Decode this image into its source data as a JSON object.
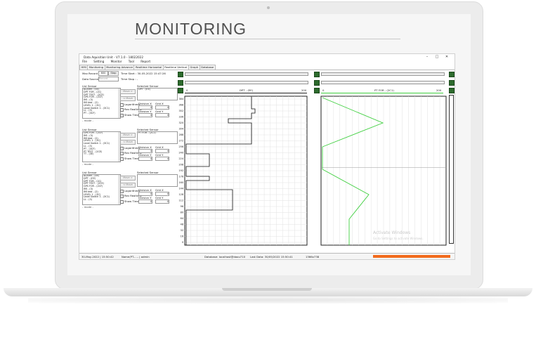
{
  "heading": "MONITORING",
  "app": {
    "title": "Data Aquisition Unit - V7.1.0 - 18022022",
    "window_buttons": [
      "–",
      "□",
      "✕"
    ],
    "menu": [
      "File",
      "Setting",
      "Monitor",
      "Tool",
      "Report"
    ],
    "tabs": [
      "HMI",
      "Monitoring",
      "Monitoring Advance",
      "Realtime Horizontal",
      "Realtime Vertical",
      "Graph",
      "Database"
    ],
    "active_tab": "Realtime Vertical",
    "max_record_label": "Max Record",
    "max_record_value": "600",
    "stop_button": "Stop",
    "data_source_label": "Data Source",
    "data_source_value": "Record",
    "time_start": "Time Start : 30-05-2022 15:47:26",
    "time_stop": "Time Stop : -"
  },
  "panels": [
    {
      "list_label": "List Sensor",
      "selected_label": "Selected Sensor",
      "items": [
        "ALARM - (EE)",
        "DPT FOR - (2C)",
        "DPT TEST - (2CE)",
        "GPS FOR - (2CF)",
        "IMI - (3)",
        "IMI test - (2)",
        "LEVEL 1 - (3C)",
        "Level Switch 1 - (3C1)",
        "LL - (3)",
        "PT - (3CF)"
      ],
      "selected": [
        "DPT - (EE)"
      ],
      "logarithmic": "Logarithmic",
      "rev_realtime": "Rev Realtime",
      "show_time": "Show Time",
      "division_x_label": "Division X",
      "grid_x_label": "Grid X",
      "division_x": "4",
      "grid_x": "4",
      "division_y_label": "Division Y",
      "grid_y_label": "Grid Y",
      "division_y": "4",
      "grid_y": "4",
      "mode": "- mode -",
      "move_btn": "Move >",
      "remove_btn": "< Move"
    },
    {
      "list_label": "List Sensor",
      "selected_label": "Selected Sensor",
      "items": [
        "GPS FOR - (2CF)",
        "IMI - (3)",
        "IMI test - (2)",
        "LEVEL 1 - (3C)",
        "Level Switch 1 - (3C1)",
        "LL - (3)",
        "PT - (3CF)",
        "PT TEST - (2CE)",
        "TT - (3E)"
      ],
      "selected": [
        "PT FOR - (2C1)"
      ],
      "logarithmic": "Logarithmic",
      "rev_realtime": "Rev Realtime",
      "show_time": "Show Time",
      "division_x_label": "Division X",
      "grid_x_label": "Grid X",
      "division_x": "4",
      "grid_x": "4",
      "division_y_label": "Division Y",
      "grid_y_label": "Grid Y",
      "division_y": "4",
      "grid_y": "4",
      "mode": "- mode -",
      "move_btn": "Move >",
      "remove_btn": "< Move"
    },
    {
      "list_label": "List Sensor",
      "selected_label": "Selected Sensor",
      "items": [
        "ALARM - (EE)",
        "DPT - (EE)",
        "DPT FOR - (2C)",
        "DPT TEST - (2CE)",
        "GPS FOR - (2CF)",
        "IMI - (3)",
        "IMI test - (2)",
        "LEVEL 1 - (3C)",
        "Level Switch 1 - (3C1)",
        "LL - (3)"
      ],
      "selected": [],
      "logarithmic": "Logarithmic",
      "rev_realtime": "Rev Realtime",
      "show_time": "Show Time",
      "division_x_label": "Division X",
      "grid_x_label": "Grid X",
      "division_x": "0",
      "grid_x": "0",
      "division_y_label": "Division Y",
      "grid_y_label": "Grid Y",
      "division_y": "0",
      "grid_y": "0",
      "mode": "- mode -",
      "move_btn": "Move >",
      "remove_btn": "< Move"
    }
  ],
  "graph1": {
    "sensor": "DPT - (EE)",
    "min": "0",
    "max": "200",
    "y_ticks": [
      "384",
      "368",
      "352",
      "336",
      "320",
      "304",
      "288",
      "272",
      "256",
      "240",
      "224",
      "208",
      "192",
      "176",
      "160",
      "144",
      "128",
      "112",
      "96",
      "80",
      "64",
      "48",
      "32",
      "16",
      "0"
    ]
  },
  "graph2": {
    "sensor": "PT FOR - (2C1)",
    "min": "0",
    "max": "200"
  },
  "status": {
    "datetime": "30-May-2022 | 15:50:42",
    "user": "Name(PT...... | admin",
    "database": "Database: localhost@daou710",
    "last_data": "Last Data: 30/05/2022 15:50:41",
    "resolution": "1366x738",
    "progress": 1.0
  },
  "watermark": {
    "title": "Activate Windows",
    "subtitle": "Go to Settings to activate Windows."
  },
  "colors": {
    "accent": "#f26b1d",
    "trace2": "#3ecf3e",
    "icon": "#2d6b2d"
  }
}
